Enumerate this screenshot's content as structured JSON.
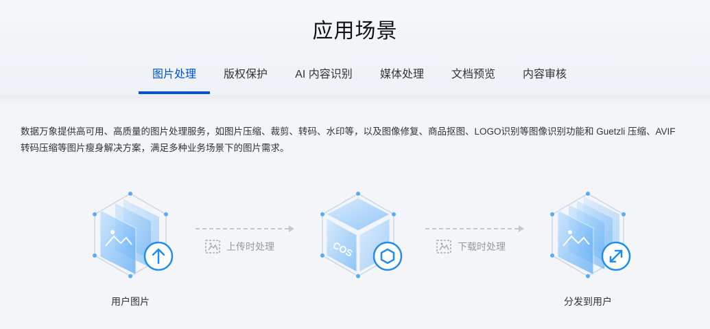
{
  "section": {
    "title": "应用场景"
  },
  "tabs": [
    {
      "label": "图片处理",
      "active": true
    },
    {
      "label": "版权保护",
      "active": false
    },
    {
      "label": "AI 内容识别",
      "active": false
    },
    {
      "label": "媒体处理",
      "active": false
    },
    {
      "label": "文档预览",
      "active": false
    },
    {
      "label": "内容审核",
      "active": false
    }
  ],
  "content": {
    "description_line1": "数据万象提供高可用、高质量的图片处理服务，如图片压缩、裁剪、转码、水印等，以及图像修复、商品抠图、LOGO识别等图像识别功能和 Guetzli 压缩、AVIF",
    "description_line2": "转码压缩等图片瘦身解决方案，满足多种业务场景下的图片需求。"
  },
  "flow": {
    "user_image_label": "用户图片",
    "cos_text": "COS",
    "upload_process_label": "上传时处理",
    "download_process_label": "下载时处理",
    "distribute_label": "分发到用户"
  },
  "colors": {
    "accent": "#0052d9",
    "icon_blue": "#1f8cf0"
  }
}
